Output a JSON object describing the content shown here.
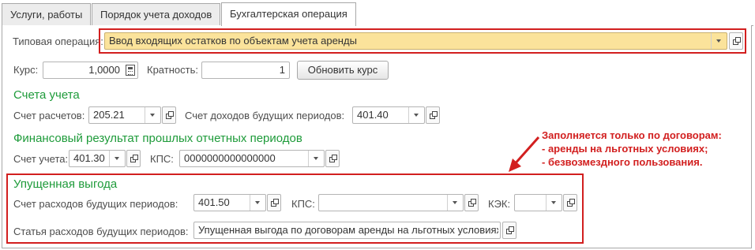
{
  "tabs": [
    {
      "label": "Услуги, работы"
    },
    {
      "label": "Порядок учета доходов"
    },
    {
      "label": "Бухгалтерская операция"
    }
  ],
  "operation": {
    "label": "Типовая операция:",
    "value": "Ввод входящих остатков по объектам учета аренды"
  },
  "rate": {
    "label": "Курс:",
    "value": "1,0000",
    "multiplicity_label": "Кратность:",
    "multiplicity_value": "1",
    "update_button": "Обновить курс"
  },
  "accounts": {
    "title": "Счета учета",
    "settlement_label": "Счет расчетов:",
    "settlement_value": "205.21",
    "deferred_income_label": "Счет доходов будущих периодов:",
    "deferred_income_value": "401.40"
  },
  "prior_result": {
    "title": "Финансовый результат прошлых отчетных периодов",
    "account_label": "Счет учета:",
    "account_value": "401.30",
    "kps_label": "КПС:",
    "kps_value": "0000000000000000"
  },
  "lost_profit": {
    "title": "Упущенная выгода",
    "deferred_expense_label": "Счет расходов будущих периодов:",
    "deferred_expense_value": "401.50",
    "kps_label": "КПС:",
    "kps_value": "",
    "kek_label": "КЭК:",
    "kek_value": "",
    "item_label": "Статья расходов будущих периодов:",
    "item_value": "Упущенная выгода по договорам аренды на льготных условиях"
  },
  "annotation": {
    "line1": "Заполняется только по договорам:",
    "line2": "- аренды на льготных условиях;",
    "line3": "- безвозмездного пользования."
  },
  "colors": {
    "highlight_red": "#d21f1f",
    "section_green": "#1e9b3a",
    "operation_field_bg": "#fbe39b"
  }
}
